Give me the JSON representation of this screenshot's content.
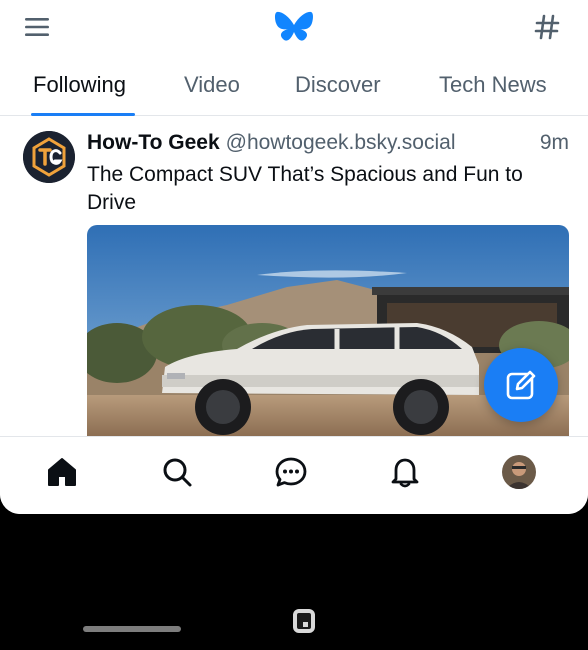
{
  "topbar": {
    "menu_icon": "hamburger-menu-icon",
    "logo_icon": "bluesky-butterfly-icon",
    "feeds_icon": "hashtag-icon",
    "brand_color": "#1185fe"
  },
  "tabs": [
    {
      "label": "Following",
      "active": true
    },
    {
      "label": "Video",
      "active": false
    },
    {
      "label": "Discover",
      "active": false
    },
    {
      "label": "Tech News",
      "active": false
    }
  ],
  "post": {
    "author": "How-To Geek",
    "handle": "@howtogeek.bsky.social",
    "time": "9m",
    "text": "The Compact SUV That’s Spacious and Fun to Drive",
    "avatar_icon": "howtogeek-logo-avatar",
    "image": "white-compact-suv-desert-photo"
  },
  "fab": {
    "icon": "compose-icon",
    "color": "#1a7ef5"
  },
  "bottom_nav": [
    {
      "name": "home",
      "icon": "home-icon",
      "active": true
    },
    {
      "name": "search",
      "icon": "search-icon",
      "active": false
    },
    {
      "name": "chat",
      "icon": "chat-icon",
      "active": false
    },
    {
      "name": "notifications",
      "icon": "bell-icon",
      "active": false
    },
    {
      "name": "profile",
      "icon": "profile-avatar",
      "active": false
    }
  ],
  "system": {
    "home_gesture": "gesture-bar",
    "floating_button_icon": "screenshot-icon"
  }
}
